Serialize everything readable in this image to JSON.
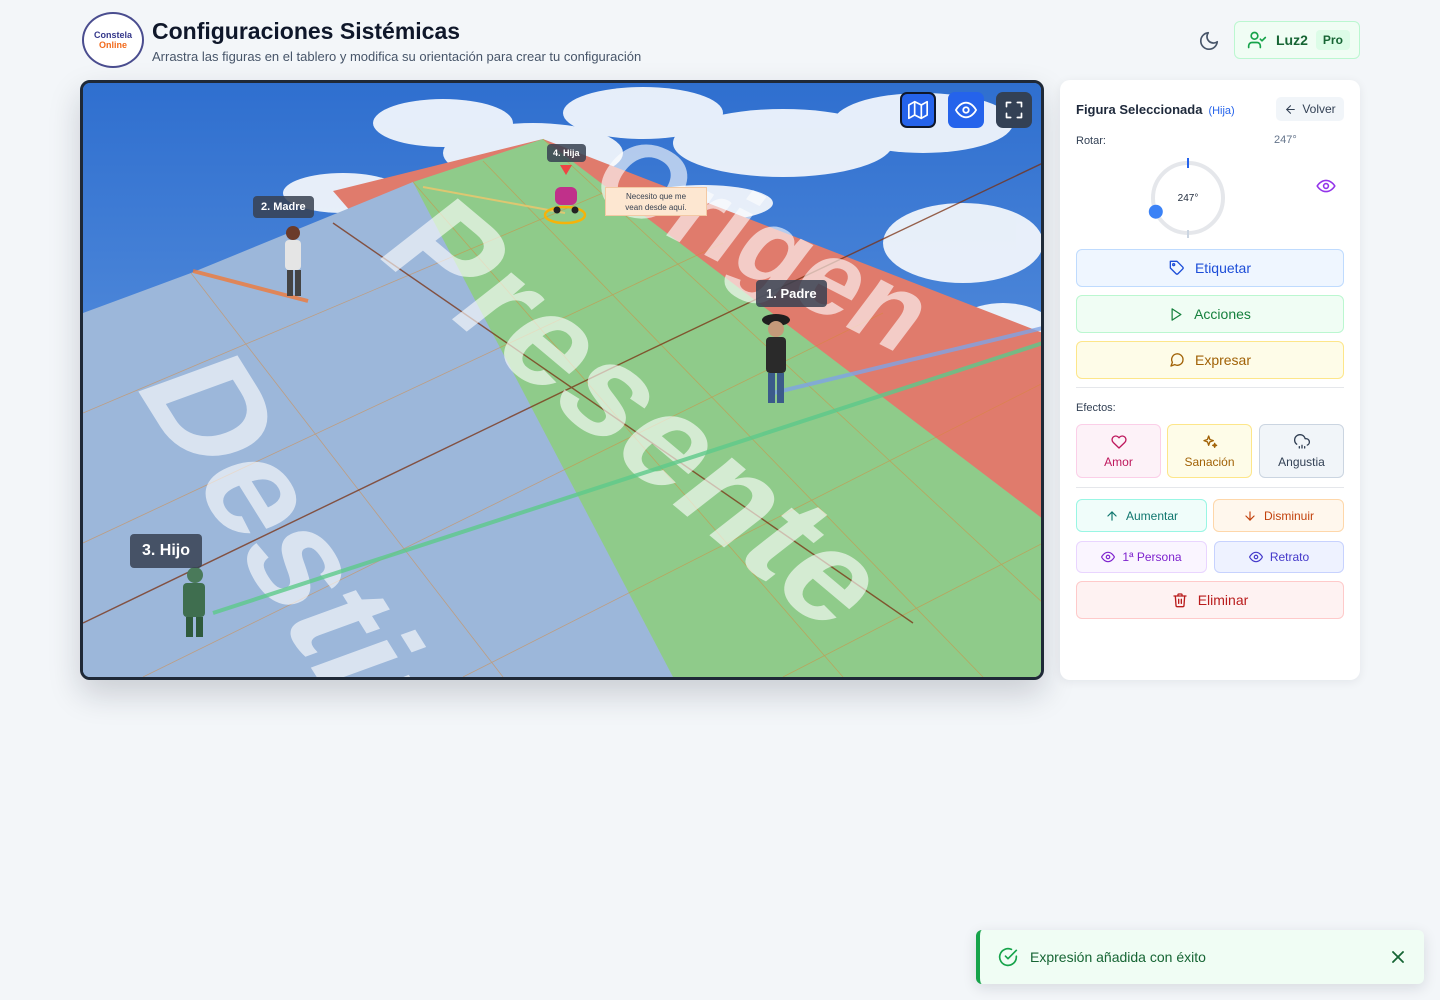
{
  "header": {
    "logo_line1": "Constela",
    "logo_line2": "Online",
    "title": "Configuraciones Sistémicas",
    "subtitle": "Arrastra las figuras en el tablero y modifica su orientación para crear tu configuración",
    "theme_icon": "moon-icon",
    "user_icon": "user-check-icon",
    "user_name": "Luz2",
    "plan_badge": "Pro"
  },
  "board": {
    "zones": [
      {
        "label": "Origen",
        "color": "#e07b6c"
      },
      {
        "label": "Presente",
        "color": "#8fcb8a"
      },
      {
        "label": "Destino",
        "color": "#9cb7da"
      }
    ],
    "toolbar": [
      {
        "name": "map-view",
        "icon": "map-icon",
        "active": true
      },
      {
        "name": "eye-view",
        "icon": "eye-icon",
        "active": true
      },
      {
        "name": "fullscreen",
        "icon": "maximize-icon",
        "active": false
      }
    ],
    "figures": [
      {
        "label": "1. Padre"
      },
      {
        "label": "2. Madre"
      },
      {
        "label": "3. Hijo"
      },
      {
        "label": "4. Hija"
      }
    ],
    "speech_bubble": {
      "line1": "Necesito que me",
      "line2": "vean desde aquí."
    }
  },
  "panel": {
    "title": "Figura Seleccionada",
    "selected_name": "(Hija)",
    "back_label": "Volver",
    "rotate_label": "Rotar:",
    "rotation_value": "247°",
    "rotation_degrees": 247,
    "actions": {
      "tag_label": "Etiquetar",
      "actions_label": "Acciones",
      "express_label": "Expresar"
    },
    "effects_label": "Efectos:",
    "effects": {
      "love": "Amor",
      "healing": "Sanación",
      "anguish": "Angustia"
    },
    "adjust": {
      "increase": "Aumentar",
      "decrease": "Disminuir",
      "first_person": "1ª Persona",
      "portrait": "Retrato"
    },
    "delete_label": "Eliminar"
  },
  "toast": {
    "message": "Expresión añadida con éxito",
    "status_color": "#16a34a"
  }
}
